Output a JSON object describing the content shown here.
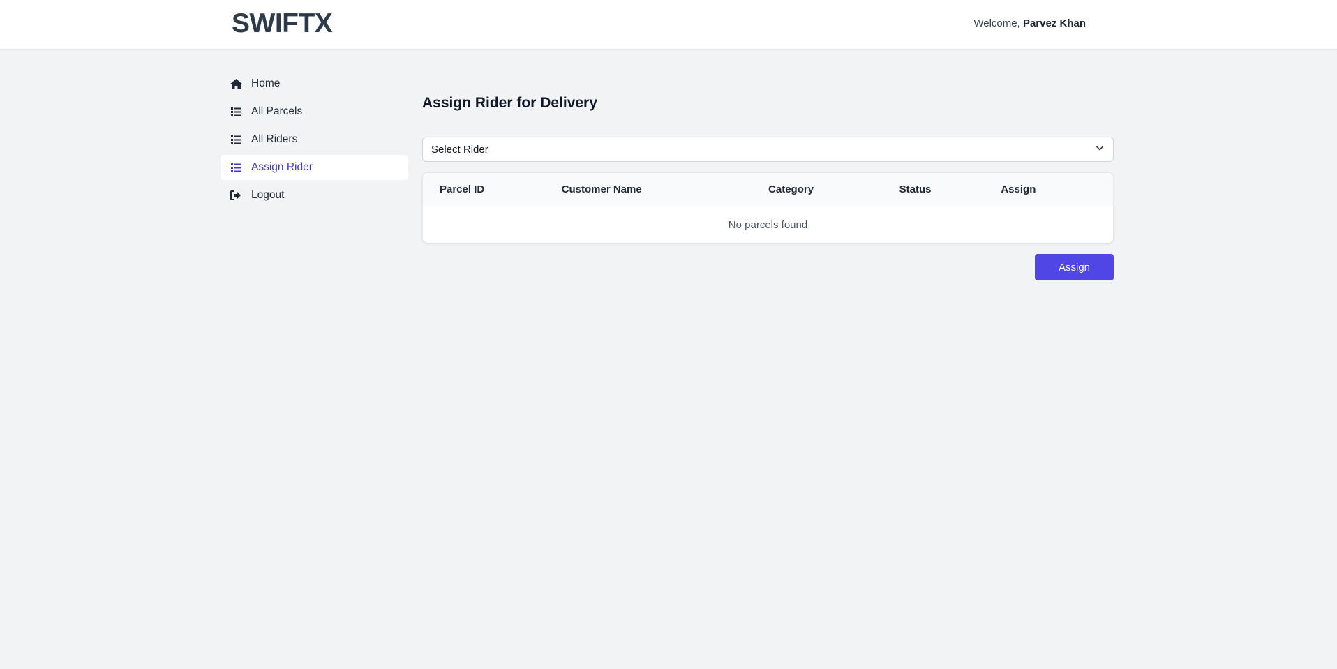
{
  "header": {
    "logo": "SWIFTX",
    "welcome_prefix": "Welcome,",
    "user_name": "Parvez Khan"
  },
  "sidebar": {
    "items": [
      {
        "label": "Home",
        "icon": "home-icon",
        "active": false
      },
      {
        "label": "All Parcels",
        "icon": "list-icon",
        "active": false
      },
      {
        "label": "All Riders",
        "icon": "list-icon",
        "active": false
      },
      {
        "label": "Assign Rider",
        "icon": "list-icon",
        "active": true
      },
      {
        "label": "Logout",
        "icon": "logout-icon",
        "active": false
      }
    ]
  },
  "main": {
    "title": "Assign Rider for Delivery",
    "rider_select": {
      "selected": "Select Rider",
      "icon": "chevron-down-icon"
    },
    "table": {
      "columns": [
        "Parcel ID",
        "Customer Name",
        "Category",
        "Status",
        "Assign"
      ],
      "empty_message": "No parcels found"
    },
    "assign_button": "Assign"
  },
  "colors": {
    "accent": "#4f46e5",
    "active_nav_text": "#4338ca",
    "logo": "#2d3a4b",
    "background": "#f2f3f5"
  }
}
